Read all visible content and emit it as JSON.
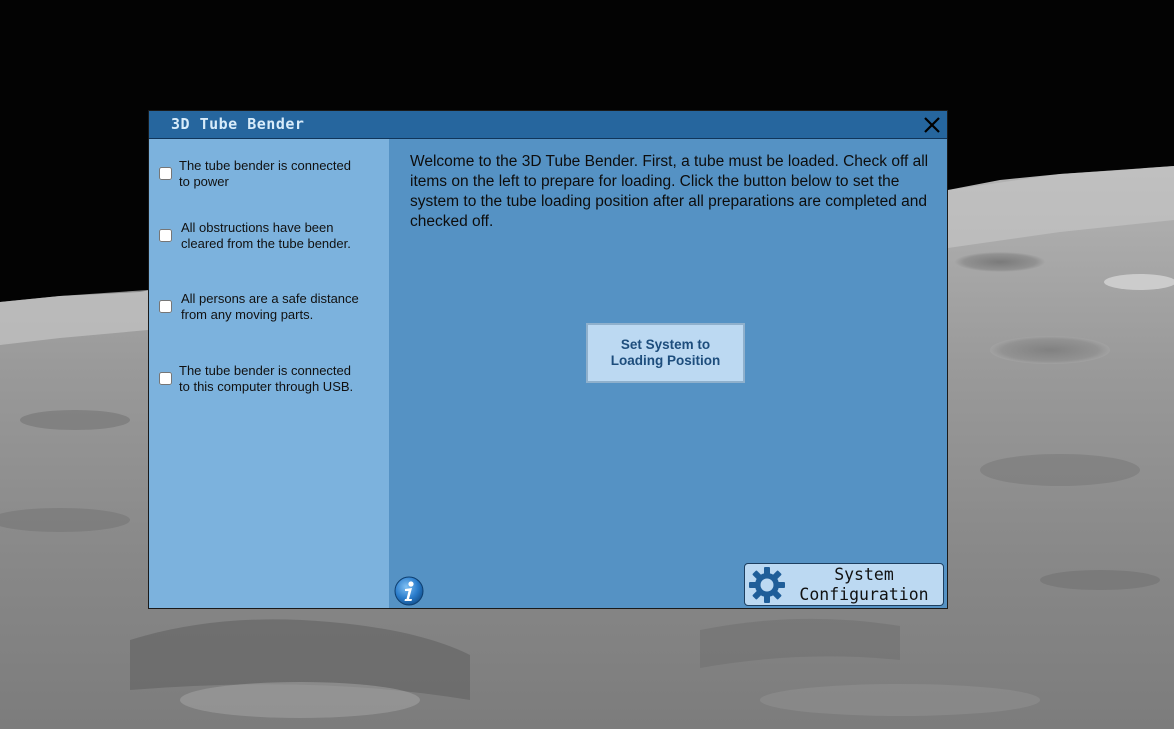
{
  "window": {
    "title": "3D Tube Bender"
  },
  "checklist": [
    {
      "label": "The tube bender is connected\nto power",
      "checked": false
    },
    {
      "label": "All obstructions have been cleared from the tube bender.",
      "checked": false
    },
    {
      "label": "All persons are a safe distance from any moving parts.",
      "checked": false
    },
    {
      "label": "The tube bender is connected\nto this computer through USB.",
      "checked": false
    }
  ],
  "main": {
    "welcome": "Welcome to the 3D Tube Bender. First, a tube must be loaded. Check off all items on the left to prepare for loading. Click the button below to set the system to the tube loading position after all preparations are completed and checked off.",
    "load_button": "Set System to Loading Position",
    "system_config_button": "System Configuration"
  },
  "icons": {
    "close": "close-icon",
    "info": "info-icon",
    "gear": "gear-icon"
  },
  "colors": {
    "titlebar": "#26669e",
    "left_panel": "#7cb2dd",
    "main_panel": "#5592c4",
    "button": "#bcd9f2"
  }
}
